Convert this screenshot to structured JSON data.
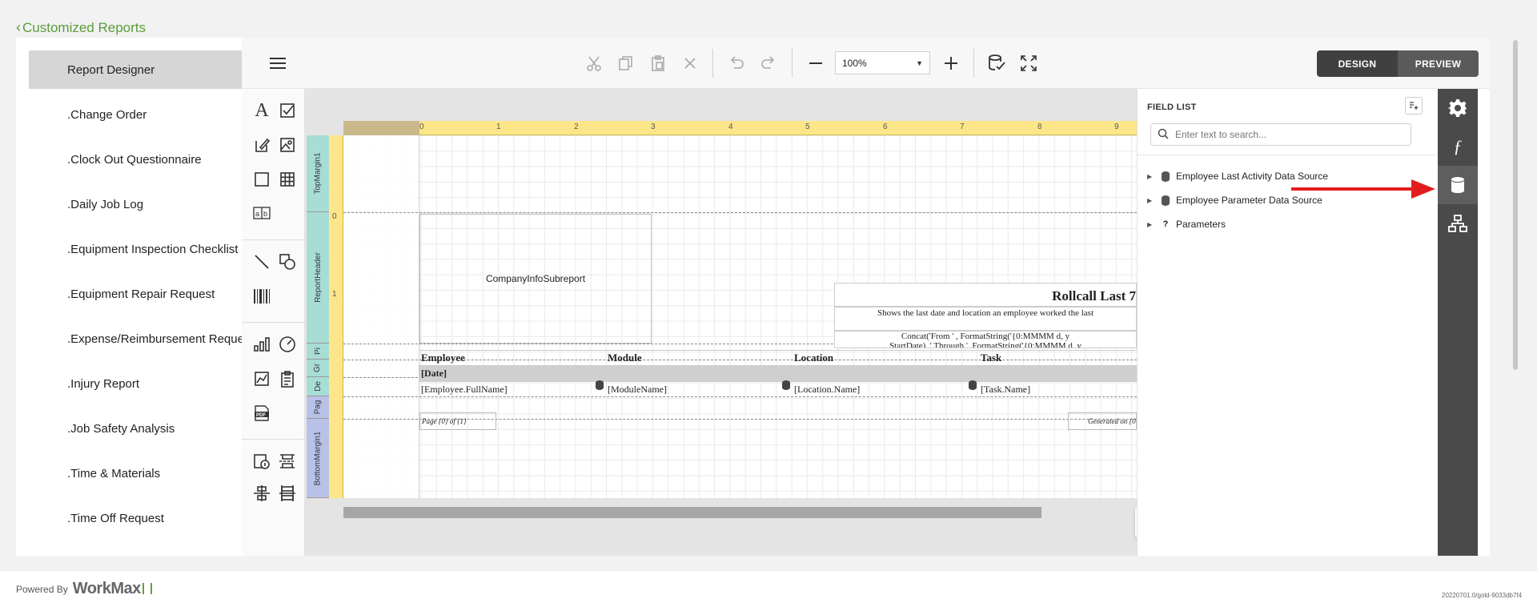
{
  "nav": {
    "back_label": "Customized Reports"
  },
  "sidebar": {
    "items": [
      {
        "label": "Report Designer",
        "active": true
      },
      {
        "label": ".Change Order"
      },
      {
        "label": ".Clock Out Questionnaire"
      },
      {
        "label": ".Daily Job Log"
      },
      {
        "label": ".Equipment Inspection Checklist"
      },
      {
        "label": ".Equipment Repair Request"
      },
      {
        "label": ".Expense/Reimbursement Request"
      },
      {
        "label": ".Injury Report"
      },
      {
        "label": ".Job Safety Analysis"
      },
      {
        "label": ".Time & Materials"
      },
      {
        "label": ".Time Off Request"
      }
    ]
  },
  "toolbar": {
    "zoom_value": "100%",
    "design_label": "DESIGN",
    "preview_label": "PREVIEW"
  },
  "ruler": {
    "numbers": [
      "0",
      "1",
      "2",
      "3",
      "4",
      "5",
      "6",
      "7",
      "8",
      "9"
    ],
    "vnumbers": [
      "0",
      "1"
    ]
  },
  "bands": [
    "TopMargin1",
    "ReportHeader",
    "Pi",
    "Gr",
    "De",
    "Pag",
    "BottomMargin1"
  ],
  "report": {
    "subreport": "CompanyInfoSubreport",
    "title": "Rollcall Last 7",
    "description": "Shows the last date and location an employee worked the last",
    "concat": "Concat('From ' , FormatString('{0:MMMM d, y",
    "concat2": "StartDate), ' Through ', FormatString('{0:MMMM d, y",
    "headers": [
      "Employee",
      "Module",
      "Location",
      "Task"
    ],
    "group_field": "[Date]",
    "detail_fields": [
      "[Employee.FullName]",
      "[ModuleName]",
      "[Location.Name]",
      "[Task.Name]"
    ],
    "page_info": "Page {0} of {1}",
    "generated": "Generated on {0"
  },
  "field_list": {
    "title": "FIELD LIST",
    "search_placeholder": "Enter text to search...",
    "items": [
      {
        "label": "Employee Last Activity Data Source",
        "icon": "database-icon"
      },
      {
        "label": "Employee Parameter Data Source",
        "icon": "database-icon"
      },
      {
        "label": "Parameters",
        "icon": "question-icon"
      }
    ]
  },
  "right_rail": [
    "gear-icon",
    "function-icon",
    "database-icon",
    "hierarchy-icon"
  ],
  "colors": {
    "accent": "#5b9c3a",
    "arrow": "#e11d1d",
    "rail": "#4a4a4a",
    "ruler": "#fde68a"
  },
  "footer": {
    "powered_by": "Powered By",
    "brand": "WorkMax",
    "version": "20220701.0/gold-9033db7f4"
  }
}
